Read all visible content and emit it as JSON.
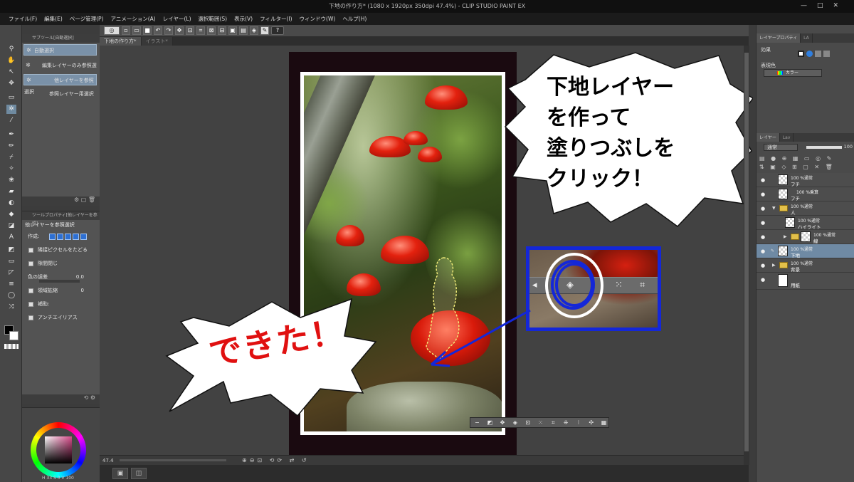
{
  "window": {
    "title": "下地の作り方* (1080 x 1920px 350dpi 47.4%) - CLIP STUDIO PAINT EX",
    "controls": [
      "—",
      "□",
      "✕"
    ]
  },
  "menu": [
    "ファイル(F)",
    "編集(E)",
    "ページ管理(P)",
    "アニメーション(A)",
    "レイヤー(L)",
    "選択範囲(S)",
    "表示(V)",
    "フィルター(I)",
    "ウィンドウ(W)",
    "ヘルプ(H)"
  ],
  "canvas_tabs": [
    {
      "label": "下地の作り方*",
      "active": true
    },
    {
      "label": "イラスト*",
      "active": false
    }
  ],
  "subtool": {
    "header": "サブツール[自動選択]",
    "items": [
      {
        "label": "自動選択",
        "selected": true
      },
      {
        "label": "編集レイヤーのみ参照選択",
        "selected": false
      },
      {
        "label": "他レイヤーを参照選択",
        "selected": true
      },
      {
        "label": "参照レイヤー用選択",
        "selected": false
      }
    ]
  },
  "tool_property": {
    "header": "ツールプロパティ[他レイヤーを参照]",
    "title": "他レイヤーを参照選択",
    "rows": [
      {
        "label": "作成:"
      },
      {
        "label": "隣接ピクセルをたどる",
        "checked": true
      },
      {
        "label": "隙間閉じ",
        "checked": true
      },
      {
        "label": "色の誤差",
        "value": "0.0"
      },
      {
        "label": "領域拡縮",
        "checked": true,
        "value": "0"
      },
      {
        "label": "補助:",
        "checked": true
      },
      {
        "label": "アンチエイリアス",
        "checked": true
      }
    ]
  },
  "color_panel": {
    "readout": "H 33 S 0 V 100",
    "colors": {
      "main": "#000000",
      "sub": "#ffffff"
    }
  },
  "status": {
    "zoom": "47.4"
  },
  "callouts": {
    "right": [
      "下地レイヤー",
      "を作って",
      "塗りつぶしを",
      "クリック！"
    ],
    "left": "できた！"
  },
  "right_panel": {
    "tabs": [
      {
        "label": "レイヤープロパティ",
        "active": true
      },
      {
        "label": "LA",
        "active": false
      }
    ],
    "effect_label": "効果",
    "display_color_label": "表現色",
    "display_color_value": "カラー"
  },
  "layers_panel": {
    "tabs": [
      {
        "label": "レイヤー",
        "active": true
      },
      {
        "label": "Lav",
        "active": false
      }
    ],
    "blend_mode": "通常",
    "opacity": "100",
    "layers": [
      {
        "line1": "100 %通常",
        "name": "フチ",
        "type": "raster",
        "indent": 0,
        "selected": false
      },
      {
        "line1": "100 %乗算",
        "name": "フチ",
        "type": "raster",
        "indent": 0,
        "selected": false
      },
      {
        "line1": "100 %通常",
        "name": "人",
        "type": "folder",
        "indent": 0,
        "selected": false
      },
      {
        "line1": "100 %通常",
        "name": "ハイライト",
        "type": "raster",
        "indent": 1,
        "selected": false
      },
      {
        "line1": "100 %通常",
        "name": "線",
        "type": "folder",
        "indent": 1,
        "selected": false
      },
      {
        "line1": "100 %通常",
        "name": "下地",
        "type": "raster",
        "indent": 0,
        "selected": true
      },
      {
        "line1": "100 %通常",
        "name": "背景",
        "type": "folder",
        "indent": 0,
        "selected": false
      },
      {
        "line1": "",
        "name": "用紙",
        "type": "paper",
        "indent": 0,
        "selected": false
      }
    ]
  },
  "accent": {
    "highlight_blue": "#1427d8",
    "callout_red": "#e01010",
    "selection": "#6f8aa4"
  }
}
